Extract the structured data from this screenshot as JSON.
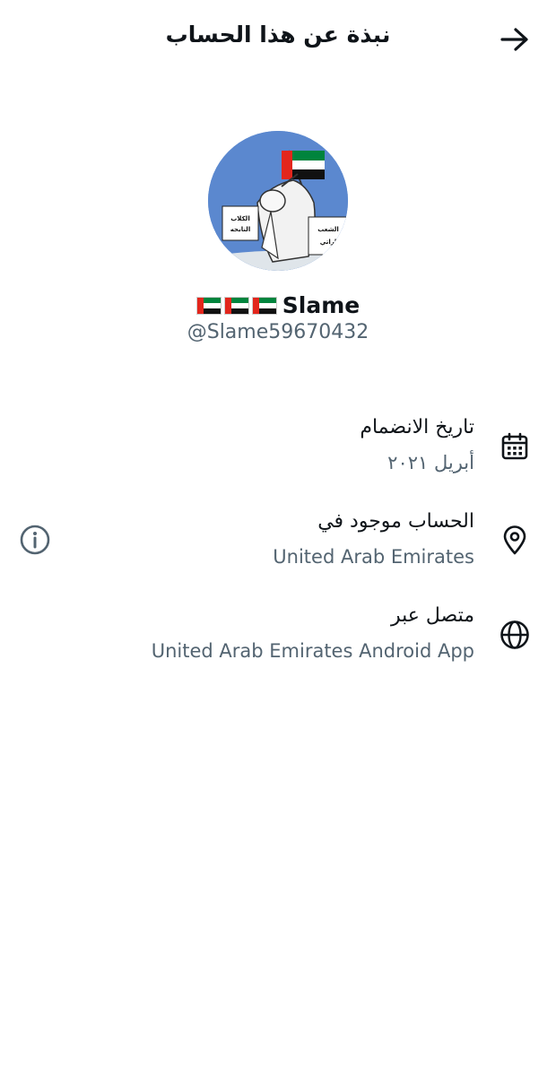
{
  "header": {
    "title": "نبذة عن هذا الحساب",
    "back_icon": "arrow-right-icon"
  },
  "profile": {
    "display_name": "Slame",
    "name_emojis": [
      "uae-flag",
      "uae-flag",
      "uae-flag"
    ],
    "handle": "@Slame59670432",
    "avatar_texts": {
      "left_sign": "الكلاب النابحه",
      "right_sign": "الشعب اراتي"
    }
  },
  "rows": {
    "joined": {
      "label": "تاريخ الانضمام",
      "value": "أبريل ٢٠٢١",
      "icon": "calendar-icon"
    },
    "location": {
      "label": "الحساب موجود في",
      "value": "United Arab Emirates",
      "icon": "location-pin-icon",
      "info_icon": "info-icon"
    },
    "connected": {
      "label": "متصل عبر",
      "value": "United Arab Emirates Android App",
      "icon": "globe-icon"
    }
  },
  "colors": {
    "text_primary": "#0f1419",
    "text_secondary": "#536471",
    "avatar_bg": "#5b88cf",
    "flag_red": "#e3261c",
    "flag_green": "#00843d",
    "flag_black": "#111111"
  }
}
